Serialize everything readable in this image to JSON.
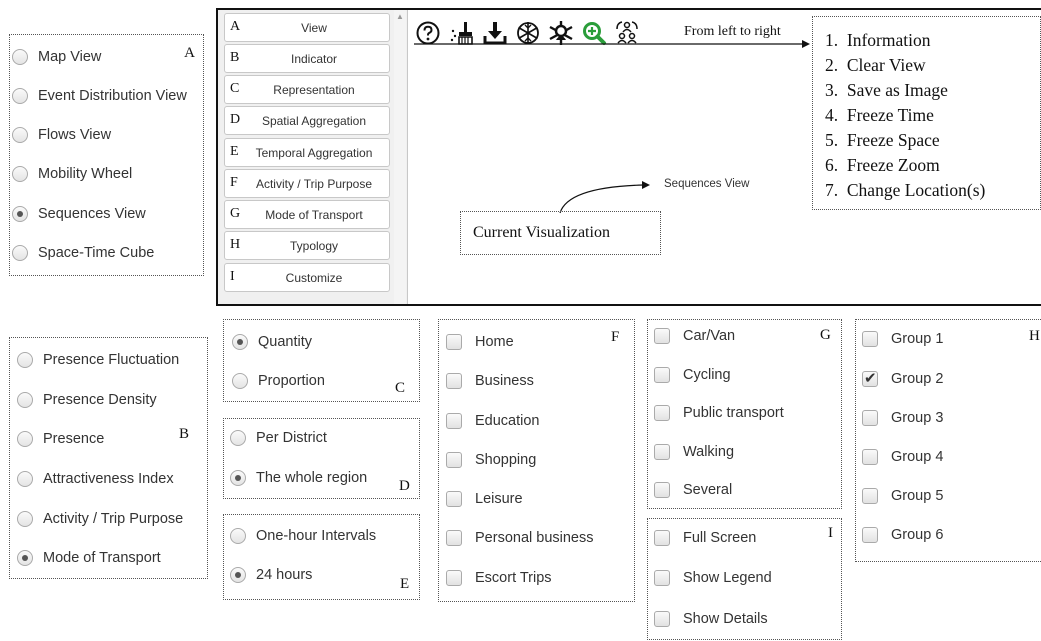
{
  "view_list": {
    "letter": "A",
    "items": [
      {
        "label": "Map View",
        "selected": false
      },
      {
        "label": "Event Distribution View",
        "selected": false
      },
      {
        "label": "Flows View",
        "selected": false
      },
      {
        "label": "Mobility Wheel",
        "selected": false
      },
      {
        "label": "Sequences View",
        "selected": true
      },
      {
        "label": "Space-Time Cube",
        "selected": false
      }
    ]
  },
  "menu": {
    "items": [
      {
        "letter": "A",
        "label": "View"
      },
      {
        "letter": "B",
        "label": "Indicator"
      },
      {
        "letter": "C",
        "label": "Representation"
      },
      {
        "letter": "D",
        "label": "Spatial Aggregation"
      },
      {
        "letter": "E",
        "label": "Temporal Aggregation"
      },
      {
        "letter": "F",
        "label": "Activity / Trip Purpose"
      },
      {
        "letter": "G",
        "label": "Mode of Transport"
      },
      {
        "letter": "H",
        "label": "Typology"
      },
      {
        "letter": "I",
        "label": "Customize"
      }
    ]
  },
  "toolbar": {
    "icons": [
      "information-icon",
      "clear-view-icon",
      "save-image-icon",
      "freeze-time-icon",
      "freeze-space-icon",
      "freeze-zoom-icon",
      "change-location-icon"
    ],
    "zoom_color": "#2a9d3a"
  },
  "annotations": {
    "left_to_right": "From left to right",
    "current_visualization": "Current Visualization",
    "sequences_view": "Sequences View",
    "legend_items": [
      "1.  Information",
      "2.  Clear View",
      "3.  Save as Image",
      "4.  Freeze Time",
      "5.  Freeze Space",
      "6.  Freeze Zoom",
      "7.  Change Location(s)"
    ]
  },
  "indicator": {
    "letter": "B",
    "items": [
      {
        "label": "Presence Fluctuation",
        "selected": false
      },
      {
        "label": "Presence Density",
        "selected": false
      },
      {
        "label": "Presence",
        "selected": false
      },
      {
        "label": "Attractiveness Index",
        "selected": false
      },
      {
        "label": "Activity / Trip Purpose",
        "selected": false
      },
      {
        "label": "Mode of Transport",
        "selected": true
      }
    ]
  },
  "representation": {
    "letter": "C",
    "items": [
      {
        "label": "Quantity",
        "selected": true
      },
      {
        "label": "Proportion",
        "selected": false
      }
    ]
  },
  "spatial": {
    "letter": "D",
    "items": [
      {
        "label": "Per District",
        "selected": false
      },
      {
        "label": "The whole region",
        "selected": true
      }
    ]
  },
  "temporal": {
    "letter": "E",
    "items": [
      {
        "label": "One-hour Intervals",
        "selected": false
      },
      {
        "label": "24 hours",
        "selected": true
      }
    ]
  },
  "activity": {
    "letter": "F",
    "items": [
      {
        "label": "Home",
        "checked": false
      },
      {
        "label": "Business",
        "checked": false
      },
      {
        "label": "Education",
        "checked": false
      },
      {
        "label": "Shopping",
        "checked": false
      },
      {
        "label": "Leisure",
        "checked": false
      },
      {
        "label": "Personal business",
        "checked": false
      },
      {
        "label": "Escort Trips",
        "checked": false
      }
    ]
  },
  "transport": {
    "letter": "G",
    "items": [
      {
        "label": "Car/Van",
        "checked": false
      },
      {
        "label": "Cycling",
        "checked": false
      },
      {
        "label": "Public transport",
        "checked": false
      },
      {
        "label": "Walking",
        "checked": false
      },
      {
        "label": "Several",
        "checked": false
      }
    ]
  },
  "customize": {
    "letter": "I",
    "items": [
      {
        "label": "Full Screen",
        "checked": false
      },
      {
        "label": "Show Legend",
        "checked": false
      },
      {
        "label": "Show Details",
        "checked": false
      }
    ]
  },
  "typology": {
    "letter": "H",
    "items": [
      {
        "label": "Group 1",
        "checked": false
      },
      {
        "label": "Group 2",
        "checked": true
      },
      {
        "label": "Group 3",
        "checked": false
      },
      {
        "label": "Group 4",
        "checked": false
      },
      {
        "label": "Group 5",
        "checked": false
      },
      {
        "label": "Group 6",
        "checked": false
      }
    ]
  }
}
